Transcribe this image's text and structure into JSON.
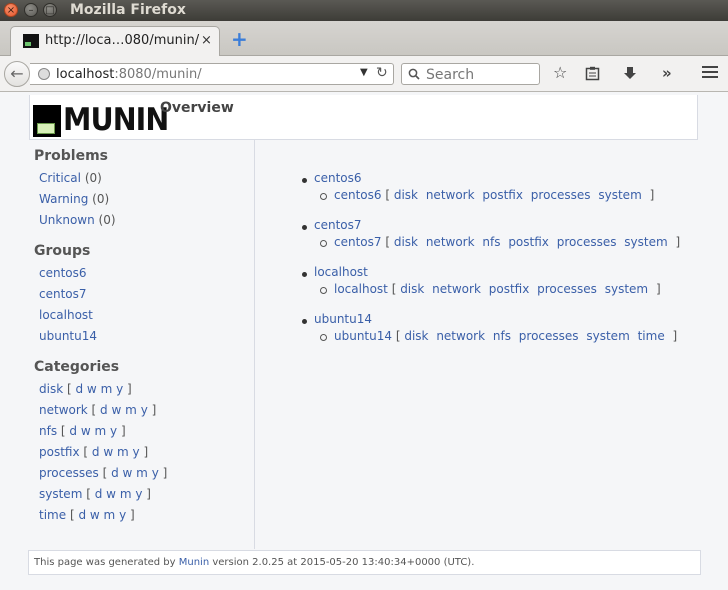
{
  "window": {
    "title": "Mozilla Firefox"
  },
  "tab": {
    "title": "http://loca…080/munin/",
    "close": "×"
  },
  "navbar": {
    "url_host": "localhost",
    "url_rest": ":8080/munin/",
    "search_placeholder": "Search"
  },
  "header": {
    "logo_text": "MUNIN",
    "title": "Overview"
  },
  "sidebar": {
    "problems_title": "Problems",
    "problems": [
      {
        "label": "Critical",
        "count": "(0)"
      },
      {
        "label": "Warning",
        "count": "(0)"
      },
      {
        "label": "Unknown",
        "count": "(0)"
      }
    ],
    "groups_title": "Groups",
    "groups": [
      "centos6",
      "centos7",
      "localhost",
      "ubuntu14"
    ],
    "categories_title": "Categories",
    "categories": [
      {
        "name": "disk",
        "periods": [
          "d",
          "w",
          "m",
          "y"
        ]
      },
      {
        "name": "network",
        "periods": [
          "d",
          "w",
          "m",
          "y"
        ]
      },
      {
        "name": "nfs",
        "periods": [
          "d",
          "w",
          "m",
          "y"
        ]
      },
      {
        "name": "postfix",
        "periods": [
          "d",
          "w",
          "m",
          "y"
        ]
      },
      {
        "name": "processes",
        "periods": [
          "d",
          "w",
          "m",
          "y"
        ]
      },
      {
        "name": "system",
        "periods": [
          "d",
          "w",
          "m",
          "y"
        ]
      },
      {
        "name": "time",
        "periods": [
          "d",
          "w",
          "m",
          "y"
        ]
      }
    ]
  },
  "groups": [
    {
      "group": "centos6",
      "host": "centos6",
      "plugins": [
        "disk",
        "network",
        "postfix",
        "processes",
        "system"
      ]
    },
    {
      "group": "centos7",
      "host": "centos7",
      "plugins": [
        "disk",
        "network",
        "nfs",
        "postfix",
        "processes",
        "system"
      ]
    },
    {
      "group": "localhost",
      "host": "localhost",
      "plugins": [
        "disk",
        "network",
        "postfix",
        "processes",
        "system"
      ]
    },
    {
      "group": "ubuntu14",
      "host": "ubuntu14",
      "plugins": [
        "disk",
        "network",
        "nfs",
        "processes",
        "system",
        "time"
      ]
    }
  ],
  "footer": {
    "prefix": "This page was generated by ",
    "link": "Munin",
    "suffix": " version 2.0.25 at 2015-05-20 13:40:34+0000 (UTC)."
  }
}
